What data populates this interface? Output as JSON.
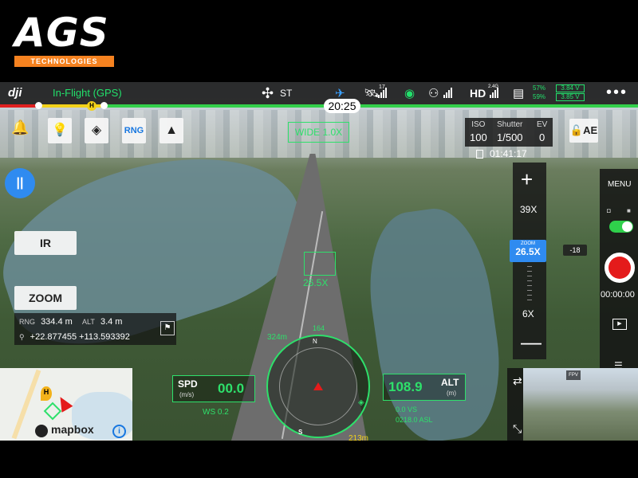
{
  "brand": {
    "logo_text": "AGS",
    "logo_subtext": "TECHNOLOGIES",
    "accent_color": "#f58220"
  },
  "statusbar": {
    "app_logo": "dji",
    "flight_mode": "In-Flight (GPS)",
    "aircraft_mode": "ST",
    "satellite_count": "17",
    "hd_band": "2.4G",
    "hd_label": "HD",
    "battery_pct_1": "57%",
    "battery_pct_2": "59%",
    "battery_v_1": "3.84 V",
    "battery_v_2": "3.85 V",
    "icons": [
      "aircraft-status-icon",
      "airplane-icon",
      "satellite-icon",
      "vision-sensor-icon",
      "remote-controller-icon",
      "battery-icon",
      "more-icon"
    ]
  },
  "flightbar": {
    "home_marker": "H",
    "time_remaining": "20:25",
    "colors": {
      "critical": "#e02020",
      "low": "#f3d21a",
      "ok": "#33d04b"
    }
  },
  "left_controls": {
    "buttons": [
      "alert-icon",
      "spotlight-icon",
      "waypoint-icon",
      "RNG",
      "navigation-icon"
    ],
    "rng_label": "RNG",
    "ir_label": "IR",
    "zoom_label": "ZOOM",
    "pause_glyph": "||"
  },
  "info_panel": {
    "rng_label": "RNG",
    "rng_value": "334.4 m",
    "alt_label": "ALT",
    "alt_value": "3.4 m",
    "coordinates": "+22.877455 +113.593392"
  },
  "camera": {
    "wide_label": "WIDE  1.0X",
    "target_zoom": "26.5X",
    "iso_label": "ISO",
    "iso_value": "100",
    "shutter_label": "Shutter",
    "shutter_value": "1/500",
    "ev_label": "EV",
    "ev_value": "0",
    "recording_time": "01:41:17",
    "lock_ae": "AE",
    "ev_badge": "-18"
  },
  "zoom_slider": {
    "max_label": "39X",
    "current_caption": "ZOOM",
    "current_value": "26.5X",
    "min_label": "6X",
    "plus": "+",
    "minus": "—"
  },
  "right_panel": {
    "menu_label": "MENU",
    "rec_timer": "00:00:00"
  },
  "telemetry": {
    "spd_label": "SPD",
    "spd_unit": "(m/s)",
    "spd_value": "00.0",
    "ws_label": "WS 0.2",
    "alt_label": "ALT",
    "alt_unit": "(m)",
    "alt_value": "108.9",
    "vs_value": "0.0  VS",
    "asl_value": "0218.0 ASL"
  },
  "compass": {
    "heading": "164",
    "distance_drone": "324m",
    "home_distance": "213m",
    "north_label": "N",
    "south_label": "S"
  },
  "map": {
    "home_marker": "H",
    "attribution": "mapbox",
    "info_glyph": "i"
  },
  "fpv": {
    "label": "FPV"
  }
}
